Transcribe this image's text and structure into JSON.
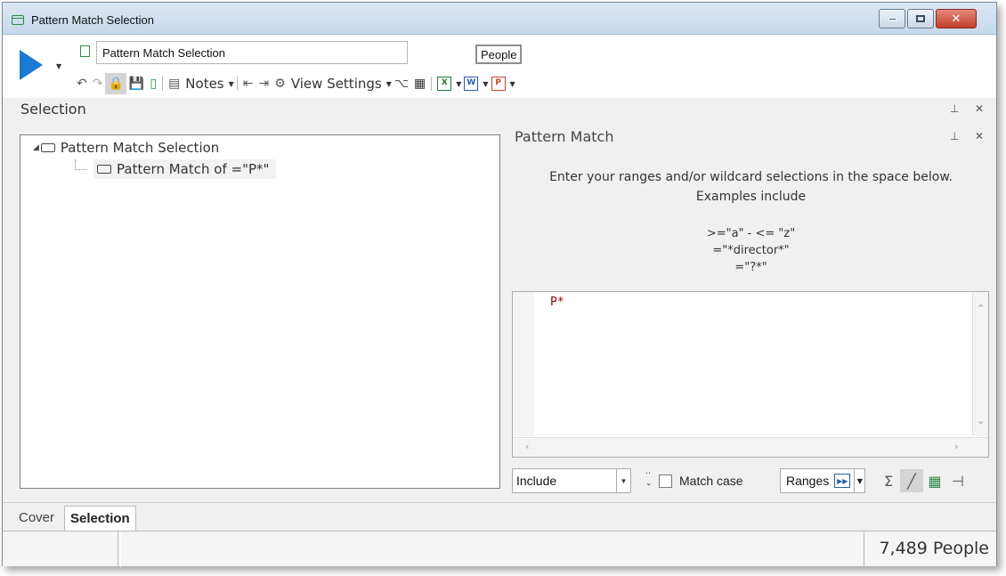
{
  "window": {
    "title": "Pattern Match Selection"
  },
  "toolbar": {
    "name_value": "Pattern Match Selection",
    "people_button": "People",
    "notes_label": "Notes",
    "view_settings_label": "View Settings"
  },
  "selection_panel": {
    "title": "Selection",
    "tree": [
      {
        "label": "Pattern Match Selection"
      },
      {
        "label": "Pattern Match of =\"P*\""
      }
    ]
  },
  "pattern_match": {
    "title": "Pattern Match",
    "instruction_line1": "Enter your ranges and/or wildcard selections in the space below.",
    "instruction_line2": "Examples  include",
    "examples": [
      ">=\"a\" - <= \"z\"",
      "=\"*director*\"",
      "=\"?*\""
    ],
    "editor_text": "P*",
    "mode_select": "Include",
    "match_case_label": "Match case",
    "match_case_checked": false,
    "ranges_label": "Ranges"
  },
  "tabs": [
    {
      "label": "Cover"
    },
    {
      "label": "Selection"
    }
  ],
  "status": {
    "count_text": "7,489 People"
  },
  "colors": {
    "run_button": "#1a7ad4",
    "accent_green": "#2a8a4a",
    "code_text": "#8b0000"
  }
}
